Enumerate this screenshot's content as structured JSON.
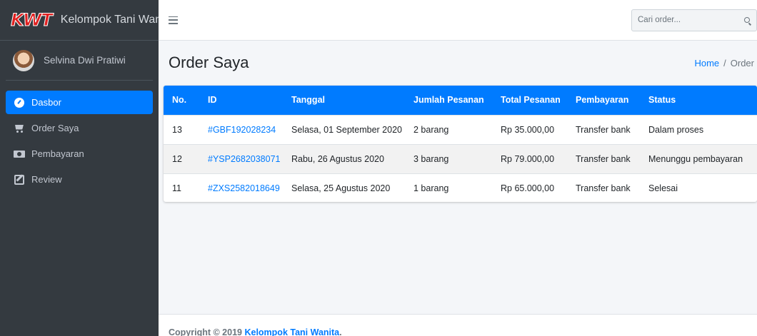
{
  "brand": {
    "logo": "KWT",
    "name": "Kelompok Tani Wanita"
  },
  "user": {
    "name": "Selvina Dwi Pratiwi"
  },
  "sidebar": {
    "items": [
      {
        "label": "Dasbor",
        "icon": "dashboard-icon",
        "active": true
      },
      {
        "label": "Order Saya",
        "icon": "cart-icon",
        "active": false
      },
      {
        "label": "Pembayaran",
        "icon": "money-bill-icon",
        "active": false
      },
      {
        "label": "Review",
        "icon": "edit-icon",
        "active": false
      }
    ]
  },
  "search": {
    "placeholder": "Cari order...",
    "value": ""
  },
  "page": {
    "title": "Order Saya"
  },
  "breadcrumb": {
    "home": "Home",
    "separator": "/",
    "current": "Order"
  },
  "table": {
    "headers": [
      "No.",
      "ID",
      "Tanggal",
      "Jumlah Pesanan",
      "Total Pesanan",
      "Pembayaran",
      "Status"
    ],
    "rows": [
      [
        "13",
        "#GBF192028234",
        "Selasa, 01 September 2020",
        "2 barang",
        "Rp 35.000,00",
        "Transfer bank",
        "Dalam proses"
      ],
      [
        "12",
        "#YSP2682038071",
        "Rabu, 26 Agustus 2020",
        "3 barang",
        "Rp 79.000,00",
        "Transfer bank",
        "Menunggu pembayaran"
      ],
      [
        "11",
        "#ZXS2582018649",
        "Selasa, 25 Agustus 2020",
        "1 barang",
        "Rp 65.000,00",
        "Transfer bank",
        "Selesai"
      ]
    ]
  },
  "footer": {
    "prefix": "Copyright © 2019 ",
    "link": "Kelompok Tani Wanita",
    "suffix": "."
  },
  "colors": {
    "primary": "#007bff",
    "sidebar": "#343a40",
    "brand_red": "#e02020"
  }
}
